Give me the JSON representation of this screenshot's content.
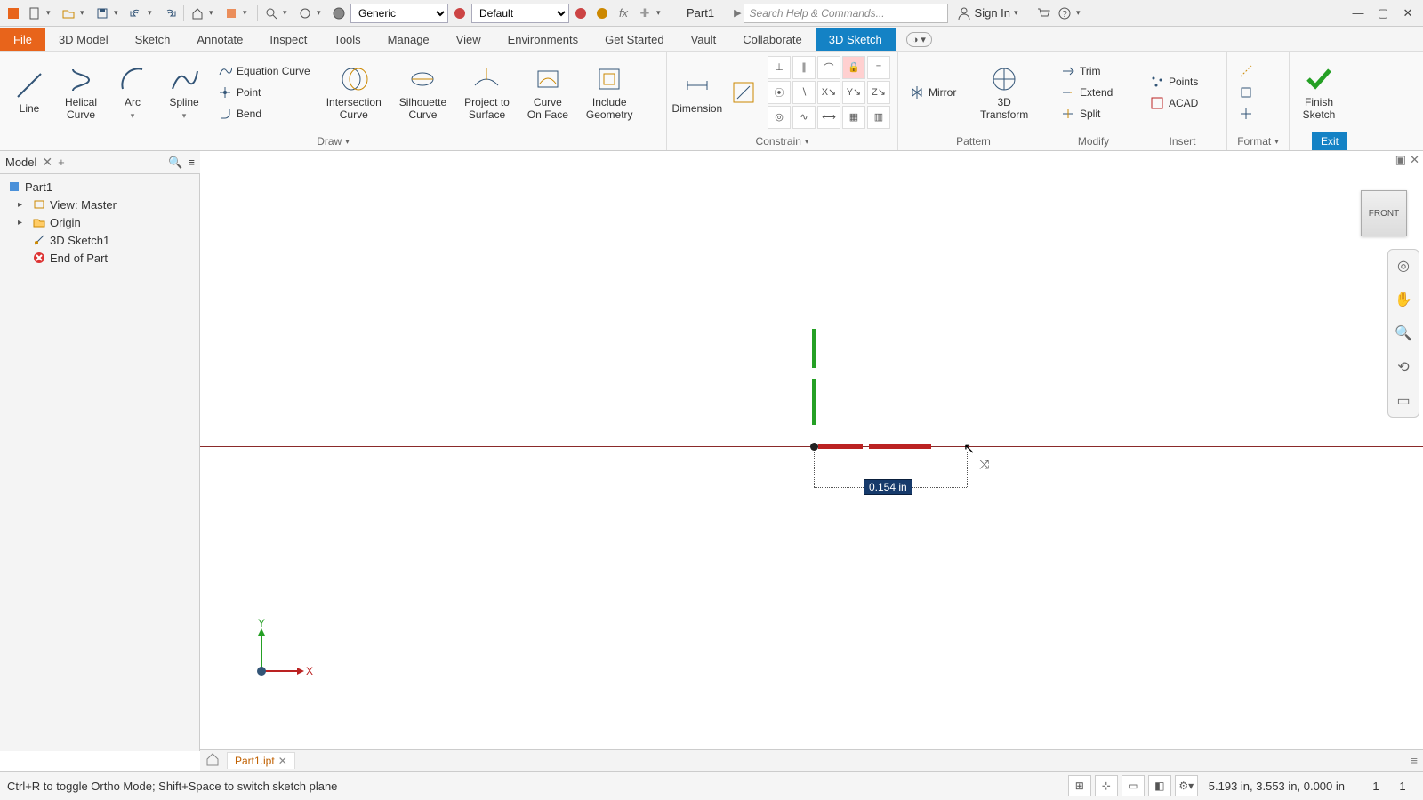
{
  "qat": {
    "part_name": "Part1",
    "combo_material": "Generic",
    "combo_appearance": "Default",
    "search_placeholder": "Search Help & Commands...",
    "signin": "Sign In"
  },
  "tabs": {
    "file": "File",
    "items": [
      "3D Model",
      "Sketch",
      "Annotate",
      "Inspect",
      "Tools",
      "Manage",
      "View",
      "Environments",
      "Get Started",
      "Vault",
      "Collaborate",
      "3D Sketch"
    ],
    "active_index": 11
  },
  "ribbon": {
    "draw": {
      "label": "Draw",
      "line": "Line",
      "helical": "Helical\nCurve",
      "arc": "Arc",
      "spline": "Spline",
      "eqcurve": "Equation Curve",
      "point": "Point",
      "bend": "Bend",
      "intersection": "Intersection\nCurve",
      "silhouette": "Silhouette\nCurve",
      "project": "Project to\nSurface",
      "curveonface": "Curve\nOn Face",
      "include": "Include\nGeometry"
    },
    "dimension": "Dimension",
    "constrain_label": "Constrain",
    "pattern": {
      "label": "Pattern",
      "mirror": "Mirror",
      "transform": "3D Transform"
    },
    "modify": {
      "label": "Modify",
      "trim": "Trim",
      "extend": "Extend",
      "split": "Split"
    },
    "insert": {
      "label": "Insert",
      "points": "Points",
      "acad": "ACAD"
    },
    "format": {
      "label": "Format"
    },
    "exit": {
      "label": "Exit",
      "finish": "Finish\nSketch"
    }
  },
  "browser": {
    "title": "Model",
    "root": "Part1",
    "nodes": [
      {
        "label": "View: Master",
        "icon": "view"
      },
      {
        "label": "Origin",
        "icon": "folder"
      },
      {
        "label": "3D Sketch1",
        "icon": "sketch"
      },
      {
        "label": "End of Part",
        "icon": "stop"
      }
    ]
  },
  "canvas": {
    "viewcube": "FRONT",
    "dim_value": "0.154 in",
    "triad": {
      "x": "X",
      "y": "Y"
    }
  },
  "doctabs": {
    "tab1": "Part1.ipt"
  },
  "status": {
    "hint": "Ctrl+R to toggle Ortho Mode; Shift+Space to switch sketch plane",
    "coords": "5.193 in, 3.553 in, 0.000 in",
    "n1": "1",
    "n2": "1"
  }
}
